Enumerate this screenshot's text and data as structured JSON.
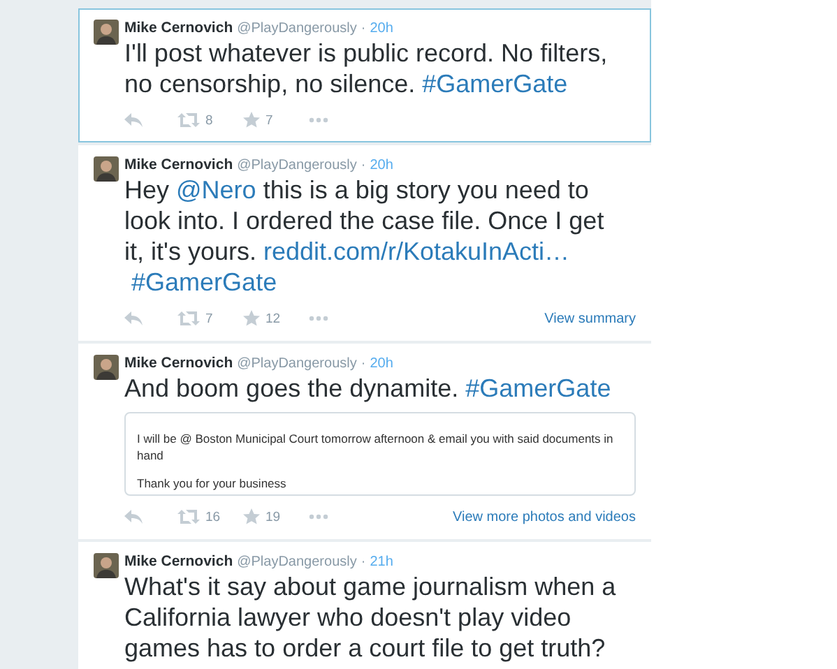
{
  "separator": "·",
  "tweets": [
    {
      "selected": true,
      "author": "Mike Cernovich",
      "handle": "@PlayDangerously",
      "time": "20h",
      "text": [
        {
          "kind": "text",
          "t": "I'll post whatever is public record. No filters, no censorship, no silence. "
        },
        {
          "kind": "link",
          "t": "#GamerGate"
        }
      ],
      "retweets": "8",
      "favorites": "7"
    },
    {
      "selected": false,
      "author": "Mike Cernovich",
      "handle": "@PlayDangerously",
      "time": "20h",
      "text": [
        {
          "kind": "text",
          "t": "Hey "
        },
        {
          "kind": "link",
          "t": "@Nero"
        },
        {
          "kind": "text",
          "t": " this is a big story you need to look into. I ordered the case file. Once I get it, it's yours. "
        },
        {
          "kind": "link",
          "t": "reddit.com/r/KotakuInActi…"
        },
        {
          "kind": "link",
          "t": "#GamerGate"
        }
      ],
      "retweets": "7",
      "favorites": "12",
      "more_link": "View summary"
    },
    {
      "selected": false,
      "author": "Mike Cernovich",
      "handle": "@PlayDangerously",
      "time": "20h",
      "text": [
        {
          "kind": "text",
          "t": "And boom goes the dynamite. "
        },
        {
          "kind": "link",
          "t": "#GamerGate"
        }
      ],
      "media": {
        "lines": [
          "I will be @ Boston Municipal Court tomorrow afternoon & email you with said documents in hand",
          "Thank you for your business"
        ]
      },
      "retweets": "16",
      "favorites": "19",
      "more_link": "View more photos and videos"
    },
    {
      "selected": false,
      "author": "Mike Cernovich",
      "handle": "@PlayDangerously",
      "time": "21h",
      "text": [
        {
          "kind": "text",
          "t": "What's it say about game journalism when a California lawyer who doesn't play video games has to order a court file to get truth?"
        }
      ]
    }
  ]
}
